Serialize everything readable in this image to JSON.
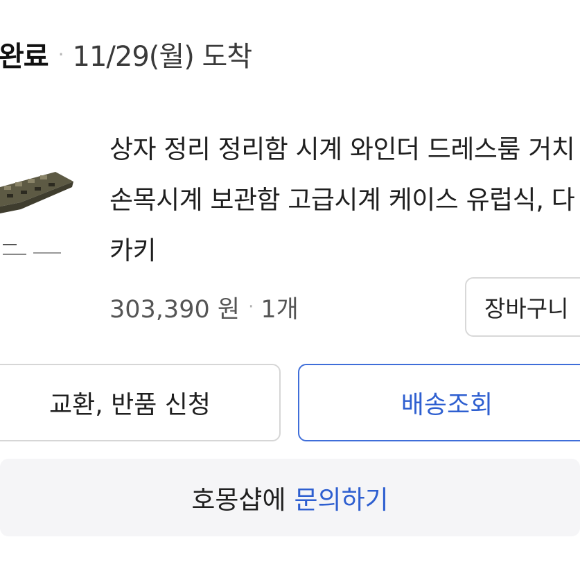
{
  "delivery": {
    "status": "완료",
    "separator": "·",
    "date": "11/29(월) 도착"
  },
  "product": {
    "image_icon": "product-photo",
    "title_lines": [
      "상자 정리 정리함 시계 와인더 드레스룸 거치",
      "손목시계 보관함 고급시계 케이스 유럽식, 다",
      "카키"
    ],
    "price": "303,390 원",
    "separator": "·",
    "quantity": "1개",
    "cart_label": "장바구니"
  },
  "actions": {
    "exchange_label": "교환, 반품 신청",
    "track_label": "배송조회"
  },
  "inquiry": {
    "shop": "호몽샵에",
    "link": "문의하기"
  },
  "colors": {
    "accent": "#2e5fd0",
    "border": "#d6d6d6",
    "inquiry_bg": "#f5f5f7"
  }
}
